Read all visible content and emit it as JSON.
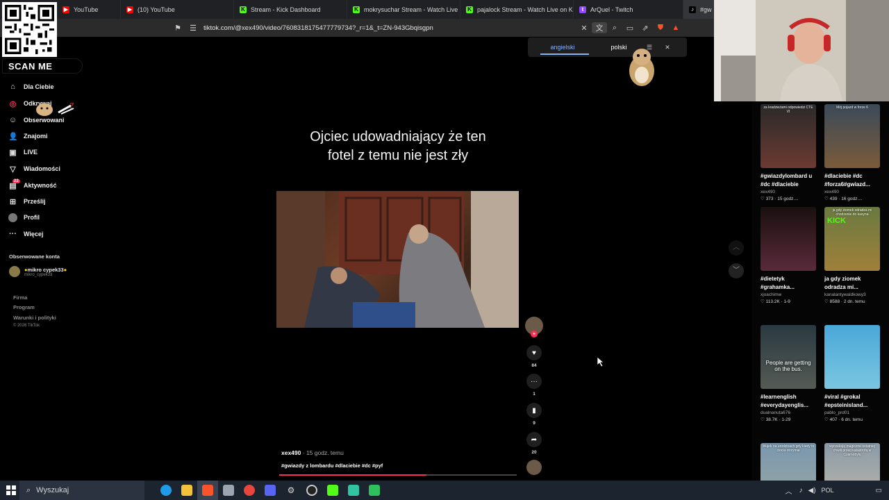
{
  "browser": {
    "tabs": [
      {
        "label": "YouTube",
        "icon": "youtube-icon",
        "color": "#ff0000"
      },
      {
        "label": "(10) YouTube",
        "icon": "youtube-icon",
        "color": "#ff0000"
      },
      {
        "label": "Stream - Kick Dashboard",
        "icon": "kick-icon",
        "color": "#53fc18"
      },
      {
        "label": "mokrysuchar Stream - Watch Live on",
        "icon": "kick-icon",
        "color": "#53fc18"
      },
      {
        "label": "pajalock Stream - Watch Live on Kick",
        "icon": "kick-icon",
        "color": "#53fc18"
      },
      {
        "label": "ArQuel - Twitch",
        "icon": "twitch-icon",
        "color": "#9146ff"
      },
      {
        "label": "#gw",
        "icon": "tiktok-icon",
        "color": "#ffffff"
      }
    ],
    "url": "tiktok.com/@xex490/video/7608318175477779734?_r=1&_t=ZN-943Gbqisgpn"
  },
  "overlay": {
    "scan_me": "SCAN ME"
  },
  "sidebar": {
    "items": [
      {
        "label": "Dla Ciebie",
        "icon": "home-icon"
      },
      {
        "label": "Odkrywaj",
        "icon": "compass-icon"
      },
      {
        "label": "Obserwowani",
        "icon": "following-icon"
      },
      {
        "label": "Znajomi",
        "icon": "friends-icon"
      },
      {
        "label": "LIVE",
        "icon": "live-icon"
      },
      {
        "label": "Wiadomości",
        "icon": "messages-icon"
      },
      {
        "label": "Aktywność",
        "icon": "activity-icon"
      },
      {
        "label": "Prześlij",
        "icon": "upload-icon"
      },
      {
        "label": "Profil",
        "icon": "profile-icon"
      },
      {
        "label": "Więcej",
        "icon": "more-icon"
      }
    ],
    "activity_badge": "22",
    "followed_title": "Obserwowane konta",
    "followed": [
      {
        "name": "mikro cypek33",
        "handle": "mikro_cypek33"
      }
    ],
    "footer": [
      "Firma",
      "Program",
      "Warunki i polityki",
      "© 2026 TikTok"
    ]
  },
  "translate": {
    "lang1": "angielski",
    "lang2": "polski"
  },
  "video": {
    "caption_line1": "Ojciec udowadniający że ten",
    "caption_line2": "fotel z temu nie jest zły",
    "author": "xex490",
    "time": "· 15 godz. temu",
    "hashtags": "#gwiazdy z lombardu #dlaciebie #dc #pyf",
    "progress": 0.62,
    "likes": "84",
    "comments": "1",
    "saves": "9",
    "shares": "20"
  },
  "feed": [
    {
      "title": "#gwiazdylombard u #dc #dlaciebie",
      "user": "xex490",
      "meta": "♡ 373 · 15 godz....",
      "overlay": "",
      "top": "za kradzieżami odpowiedzi CTE VI"
    },
    {
      "title": "#dlaciebie #dc #forza6#gwiazd...",
      "user": "xex490",
      "meta": "♡ 439 · 16 godz....",
      "overlay": "",
      "top": "Mój pojazd w forze 6"
    },
    {
      "title": "#dietetyk #grahamka...",
      "user": "xjoachimw",
      "meta": "♡ 113.2K · 1-9",
      "overlay": "",
      "top": ""
    },
    {
      "title": "ja gdy ziomek odradza mi...",
      "user": "kanalantywaldkowy3",
      "meta": "♡ 8588 · 2 dn. temu",
      "overlay": "KICK",
      "top": "ja gdy ziomek odradza mi chodzenie do kasyna"
    },
    {
      "title": "#learnenglish #everydayenglis...",
      "user": "dualnanuta676",
      "meta": "♡ 38.7K · 1-29",
      "overlay": "People are getting on the bus.",
      "top": ""
    },
    {
      "title": "#viral #grokal #epsteinisland...",
      "user": "pablo_prd01",
      "meta": "♡ 407 · 6 dn. temu",
      "overlay": "",
      "top": ""
    },
    {
      "title": "",
      "user": "",
      "meta": "",
      "overlay": "",
      "top": "Wujek na urodzinach gdy kiedy to ciocia otrzymał"
    },
    {
      "title": "",
      "user": "",
      "meta": "",
      "overlay": "",
      "top": "wyczekuję magiczne ostatniej chwili przed katastrofą w Czarnobylu"
    }
  ],
  "taskbar": {
    "search_placeholder": "Wyszukaj",
    "lang": "POL"
  }
}
